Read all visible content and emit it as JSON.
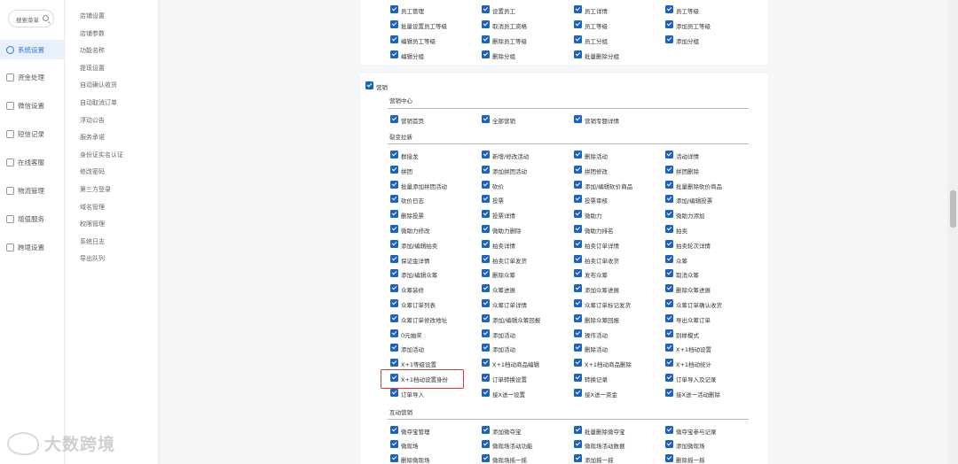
{
  "search": {
    "placeholder": "搜索菜单"
  },
  "nav": [
    {
      "label": "系统设置",
      "active": true,
      "icon": "gear-icon"
    },
    {
      "label": "资金处理",
      "active": false,
      "icon": "money-icon"
    },
    {
      "label": "微信设置",
      "active": false,
      "icon": "wechat-icon"
    },
    {
      "label": "短信记录",
      "active": false,
      "icon": "sms-icon"
    },
    {
      "label": "在线客服",
      "active": false,
      "icon": "service-icon"
    },
    {
      "label": "物流管理",
      "active": false,
      "icon": "truck-icon"
    },
    {
      "label": "增值服务",
      "active": false,
      "icon": "addon-icon"
    },
    {
      "label": "跨境设置",
      "active": false,
      "icon": "globe-icon"
    }
  ],
  "subnav": [
    "店铺设置",
    "店铺参数",
    "功能名称",
    "提现设置",
    "自动确认收货",
    "自动取消订单",
    "浮动公告",
    "服务承诺",
    "身份证实名认证",
    "修改密码",
    "第三方登录",
    "域名管理",
    "权限管理",
    "系统日志",
    "导出队列"
  ],
  "staff_rows": [
    [
      "员工管理",
      "设置员工",
      "员工详情",
      "员工等级"
    ],
    [
      "批量设置员工等级",
      "取消员工资格",
      "员工等级",
      "添加员工等级"
    ],
    [
      "编辑员工等级",
      "删除员工等级",
      "员工分组",
      "添加分组"
    ],
    [
      "编辑分组",
      "删除分组",
      "批量删除分组"
    ]
  ],
  "marketing": {
    "title": "营销",
    "sections": [
      {
        "title": "营销中心",
        "rows": [
          [
            "营销首页",
            "全部营销",
            "营销专题详情"
          ]
        ]
      },
      {
        "title": "裂变拉新",
        "rows": [
          [
            "群接龙",
            "新增/修改活动",
            "删除活动",
            "活动详情"
          ],
          [
            "拼团",
            "添加拼团活动",
            "拼团修改",
            "拼团删除"
          ],
          [
            "批量添加拼团活动",
            "砍价",
            "添加/编辑砍价商品",
            "批量删除砍价商品"
          ],
          [
            "砍价日志",
            "投票",
            "投票审核",
            "添加/编辑投票"
          ],
          [
            "删除投票",
            "投票详情",
            "微助力",
            "微助力添加"
          ],
          [
            "微助力修改",
            "微助力删除",
            "微助力排名",
            "拍卖"
          ],
          [
            "添加/编辑拍卖",
            "拍卖详情",
            "拍卖订单详情",
            "拍卖轮次详情"
          ],
          [
            "保证金详情",
            "拍卖订单发货",
            "拍卖订单收货",
            "众筹"
          ],
          [
            "添加/编辑众筹",
            "删除众筹",
            "发布众筹",
            "取消众筹"
          ],
          [
            "众筹装修",
            "众筹进展",
            "添加众筹进展",
            "删除众筹进展"
          ],
          [
            "众筹订单列表",
            "众筹订单详情",
            "众筹订单标记发货",
            "众筹订单确认收货"
          ],
          [
            "众筹订单修改地址",
            "添加/编辑众筹回报",
            "删除众筹回报",
            "导出众筹订单"
          ],
          [
            "0元抽奖",
            "添加活动",
            "操作活动",
            "别样模式"
          ],
          [
            "添加活动",
            "添加活动",
            "删除活动",
            "X+1档动设置"
          ],
          [
            "X+1等级设置",
            "X+1档动商品编辑",
            "X+1档动商品删除",
            "X+1档动统计"
          ],
          [
            "X+1档动设置身份",
            "订单转换设置",
            "转换记录",
            "订单导入及记录"
          ],
          [
            "订单导入",
            "接X送一设置",
            "接X送一资金",
            "接X送一活动删除"
          ]
        ]
      },
      {
        "title": "互动营销",
        "rows": [
          [
            "微夺宝管理",
            "添加微夺宝",
            "批量删除微夺宝",
            "微夺宝参与记录"
          ],
          [
            "微现场",
            "微现场活动功能",
            "微现场活动数据",
            "添加微现场"
          ],
          [
            "删除微现场",
            "微现场摇一摇",
            "添加摇一摇",
            "删除摇一摇"
          ]
        ]
      }
    ]
  },
  "watermark": "大数跨境",
  "colors": {
    "accent": "#1a63c4",
    "highlight": "#e03a3a",
    "nav_active_bg": "#e8f0fc"
  }
}
